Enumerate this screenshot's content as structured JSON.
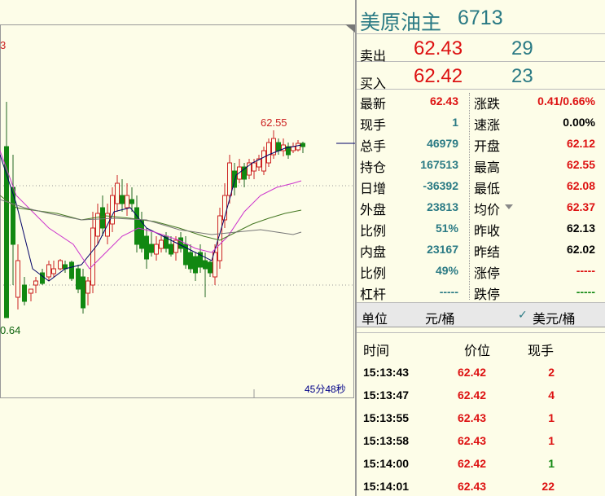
{
  "chart": {
    "high_label": "62.55",
    "low_label": "0.64",
    "edge_label": "3",
    "time_remaining": "45分48秒",
    "colors": {
      "up": "#cc2222",
      "down": "#118811",
      "ma_fast": "#000066",
      "ma_mid": "#cc33cc",
      "ma_slow": "#447722",
      "ma_long": "#777777"
    }
  },
  "panel": {
    "name": "美原油主",
    "code": "6713",
    "sell_label": "卖出",
    "sell_price": "62.43",
    "sell_volume": "29",
    "buy_label": "买入",
    "buy_price": "62.42",
    "buy_volume": "23",
    "stats": [
      {
        "l_label": "最新",
        "l_value": "62.43",
        "l_color": "c-red",
        "r_label": "涨跌",
        "r_value": "0.41/0.66%",
        "r_color": "c-red"
      },
      {
        "l_label": "现手",
        "l_value": "1",
        "l_color": "c-teal",
        "r_label": "速涨",
        "r_value": "0.00%",
        "r_color": "c-black"
      },
      {
        "l_label": "总手",
        "l_value": "46979",
        "l_color": "c-teal",
        "r_label": "开盘",
        "r_value": "62.12",
        "r_color": "c-red"
      },
      {
        "l_label": "持仓",
        "l_value": "167513",
        "l_color": "c-teal",
        "r_label": "最高",
        "r_value": "62.55",
        "r_color": "c-red"
      },
      {
        "l_label": "日增",
        "l_value": "-36392",
        "l_color": "c-teal",
        "r_label": "最低",
        "r_value": "62.08",
        "r_color": "c-red"
      },
      {
        "l_label": "外盘",
        "l_value": "23813",
        "l_color": "c-teal",
        "r_label": "均价",
        "r_value": "62.37",
        "r_color": "c-red"
      },
      {
        "l_label": "比例",
        "l_value": "51%",
        "l_color": "c-teal",
        "r_label": "昨收",
        "r_value": "62.13",
        "r_color": "c-black"
      },
      {
        "l_label": "内盘",
        "l_value": "23167",
        "l_color": "c-teal",
        "r_label": "昨结",
        "r_value": "62.02",
        "r_color": "c-black"
      },
      {
        "l_label": "比例",
        "l_value": "49%",
        "l_color": "c-teal",
        "r_label": "涨停",
        "r_value": "-----",
        "r_color": "c-red"
      },
      {
        "l_label": "杠杆",
        "l_value": "-----",
        "l_color": "c-teal",
        "r_label": "跌停",
        "r_value": "-----",
        "r_color": "c-green"
      }
    ],
    "units": {
      "label": "单位",
      "yuan": "元/桶",
      "usd": "美元/桶",
      "check_icon": "check-icon"
    },
    "trades_header": {
      "time": "时间",
      "price": "价位",
      "volume": "现手"
    },
    "trades": [
      {
        "time": "15:13:43",
        "price": "62.42",
        "volume": "2",
        "vcolor": "c-red"
      },
      {
        "time": "15:13:47",
        "price": "62.42",
        "volume": "4",
        "vcolor": "c-red"
      },
      {
        "time": "15:13:55",
        "price": "62.43",
        "volume": "1",
        "vcolor": "c-red"
      },
      {
        "time": "15:13:58",
        "price": "62.43",
        "volume": "1",
        "vcolor": "c-red"
      },
      {
        "time": "15:14:00",
        "price": "62.42",
        "volume": "1",
        "vcolor": "c-green"
      },
      {
        "time": "15:14:01",
        "price": "62.43",
        "volume": "22",
        "vcolor": "c-red"
      }
    ]
  }
}
